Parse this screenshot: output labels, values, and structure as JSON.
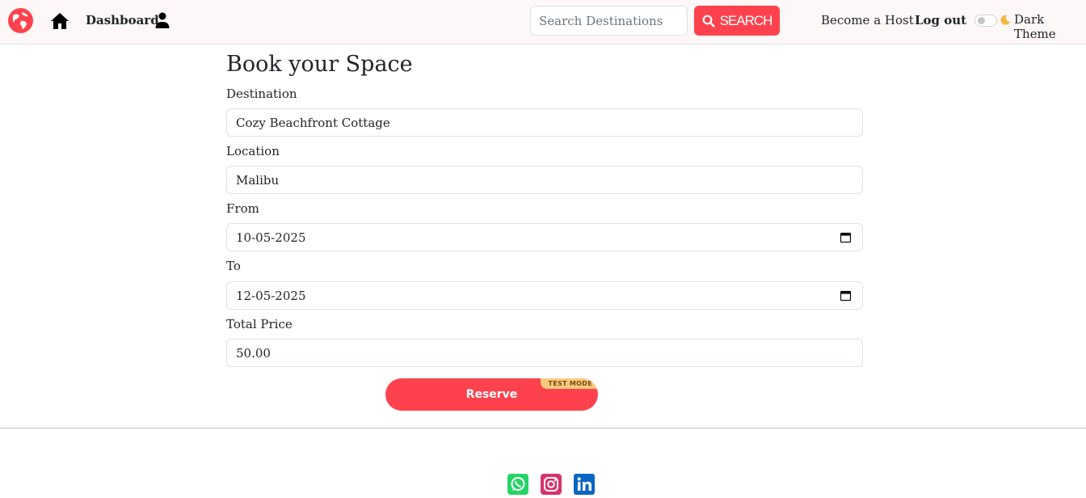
{
  "navbar": {
    "dashboard_label": "Dashboard",
    "search_placeholder": "Search Destinations",
    "search_button_label": "SEARCH",
    "become_host_label": "Become a Host",
    "logout_label": "Log out",
    "dark_theme_label": "Dark Theme",
    "dark_theme_enabled": false,
    "icons": [
      "globe-logo-icon",
      "home-icon",
      "user-icon",
      "search-icon",
      "moon-icon"
    ]
  },
  "form": {
    "title": "Book your Space",
    "fields": [
      {
        "label": "Destination",
        "value": "Cozy Beachfront Cottage"
      },
      {
        "label": "Location",
        "value": "Malibu"
      },
      {
        "label": "From",
        "value": "10-05-2025"
      },
      {
        "label": "To",
        "value": "12-05-2025"
      },
      {
        "label": "Total Price",
        "value": "50.00"
      }
    ],
    "reserve_label": "Reserve",
    "test_mode_badge": "TEST MODE"
  },
  "footer": {
    "social": [
      "whatsapp-icon",
      "instagram-icon",
      "linkedin-icon"
    ]
  },
  "colors": {
    "accent": "#fe424d",
    "navbar_bg": "#fdf7f7",
    "badge": "#f9c97c",
    "whatsapp": "#25d366",
    "instagram": "#d6336c",
    "linkedin": "#0a66c2"
  }
}
